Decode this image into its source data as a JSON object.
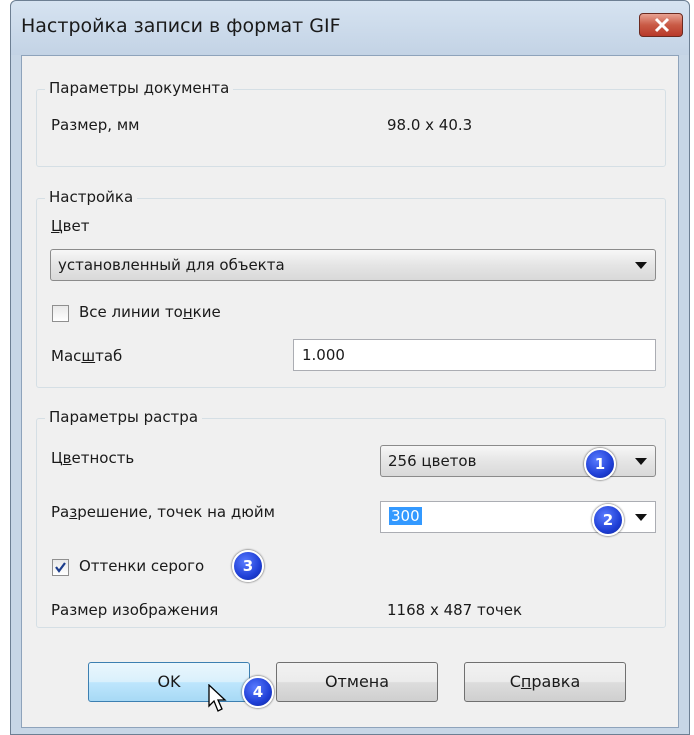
{
  "window": {
    "title": "Настройка записи в формат GIF",
    "close_icon": "close-icon"
  },
  "document_params": {
    "legend": "Параметры документа",
    "size_label": "Размер, мм",
    "size_value": "98.0 x 40.3"
  },
  "settings": {
    "legend": "Настройка",
    "color_label": "Цвет",
    "color_value": "установленный для объекта",
    "thin_lines_label": "Все линии тонкие",
    "thin_lines_checked": false,
    "scale_label": "Масштаб",
    "scale_value": "1.000"
  },
  "raster": {
    "legend": "Параметры растра",
    "color_depth_label": "Цветность",
    "color_depth_value": "256 цветов",
    "resolution_label": "Разрешение, точек на дюйм",
    "resolution_value": "300",
    "grayscale_label": "Оттенки серого",
    "grayscale_checked": true,
    "image_size_label": "Размер изображения",
    "image_size_value": "1168 x 487 точек"
  },
  "buttons": {
    "ok": "OK",
    "cancel": "Отмена",
    "help": "Справка"
  },
  "callouts": [
    "1",
    "2",
    "3",
    "4"
  ],
  "colors": {
    "accent": "#3399ff",
    "badge": "#1f3fd6",
    "close": "#c95a45"
  }
}
